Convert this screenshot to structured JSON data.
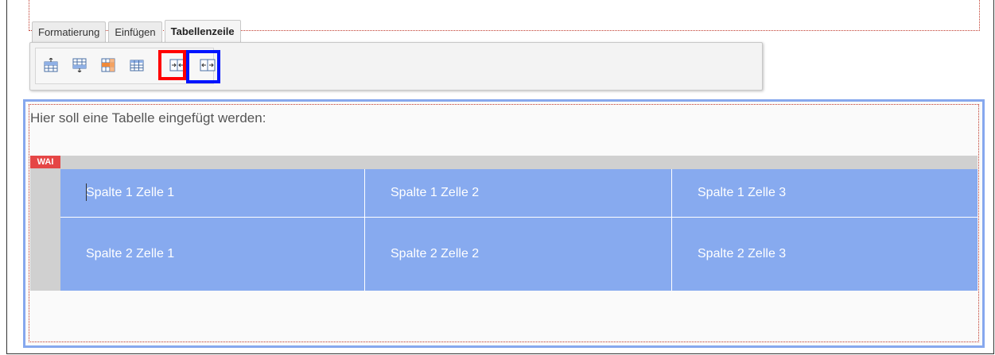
{
  "tabs": [
    {
      "label": "Formatierung"
    },
    {
      "label": "Einfügen"
    },
    {
      "label": "Tabellenzeile"
    }
  ],
  "toolbar": {
    "buttons": [
      {
        "icon": "insert-row-above-icon"
      },
      {
        "icon": "insert-row-below-icon"
      },
      {
        "icon": "delete-row-icon"
      },
      {
        "icon": "table-properties-icon"
      },
      {
        "icon": "merge-cells-icon"
      },
      {
        "icon": "split-cells-icon"
      }
    ]
  },
  "content": {
    "intro": "Hier soll eine Tabelle eingefügt werden:",
    "wai_label": "WAI",
    "table": {
      "rows": [
        [
          "Spalte 1 Zelle 1",
          "Spalte 1 Zelle 2",
          "Spalte 1 Zelle 3"
        ],
        [
          "Spalte 2 Zelle 1",
          "Spalte 2 Zelle 2",
          "Spalte 2 Zelle 3"
        ]
      ]
    }
  },
  "colors": {
    "highlight_red": "#ff0000",
    "highlight_blue": "#0014ff",
    "table_background": "#87aaef",
    "wai_badge": "#e54646"
  }
}
